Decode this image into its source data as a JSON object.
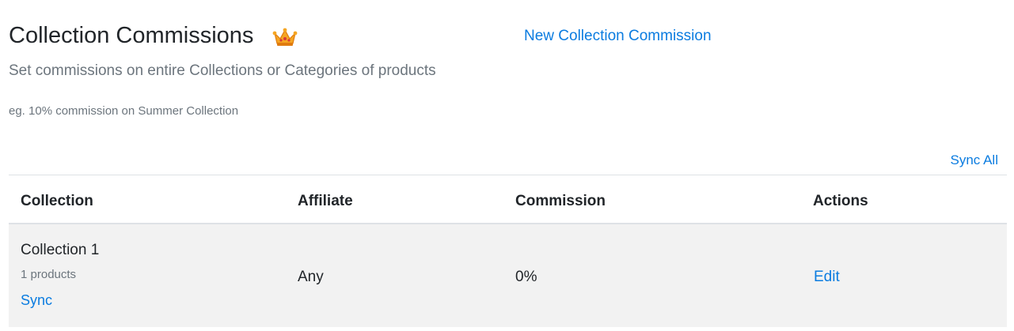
{
  "header": {
    "title": "Collection Commissions",
    "premium_icon": "crown-icon",
    "new_link": "New Collection Commission",
    "subtitle": "Set commissions on entire Collections or Categories of products",
    "example": "eg. 10% commission on Summer Collection"
  },
  "sync_all_label": "Sync All",
  "table": {
    "columns": [
      "Collection",
      "Affiliate",
      "Commission",
      "Actions"
    ],
    "rows": [
      {
        "collection": "Collection 1",
        "products": "1 products",
        "sync_label": "Sync",
        "affiliate": "Any",
        "commission": "0%",
        "action": "Edit"
      }
    ]
  },
  "colors": {
    "link": "#0b7ce0",
    "muted": "#6c757d",
    "row_bg": "#f2f2f2",
    "crown": "#f5a623"
  }
}
